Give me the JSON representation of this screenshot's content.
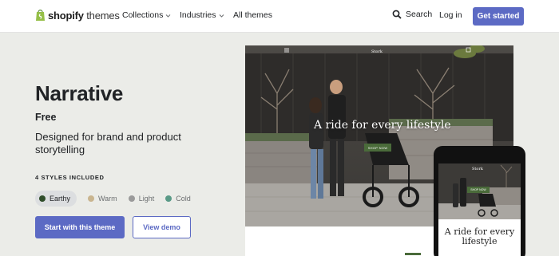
{
  "nav": {
    "logo_brand": "shopify",
    "logo_suffix": "themes",
    "items": [
      {
        "label": "Collections"
      },
      {
        "label": "Industries"
      },
      {
        "label": "All themes"
      }
    ],
    "search_label": "Search",
    "login_label": "Log in",
    "cta_label": "Get started"
  },
  "theme": {
    "name": "Narrative",
    "price": "Free",
    "description": "Designed for brand and product storytelling",
    "styles_label": "4 STYLES INCLUDED",
    "styles": [
      {
        "label": "Earthy",
        "color": "#2f4d2a"
      },
      {
        "label": "Warm",
        "color": "#c9b58f"
      },
      {
        "label": "Light",
        "color": "#9a9a9a"
      },
      {
        "label": "Cold",
        "color": "#5a9a87"
      }
    ],
    "primary_button": "Start with this theme",
    "secondary_button": "View demo"
  },
  "preview": {
    "store_name": "Stork",
    "hero_text": "A ride for every lifestyle",
    "shop_button": "SHOP NOW",
    "phone_hero_line1": "A ride for every",
    "phone_hero_line2": "lifestyle"
  },
  "colors": {
    "accent": "#5c6ac4",
    "background": "#ebece8"
  }
}
